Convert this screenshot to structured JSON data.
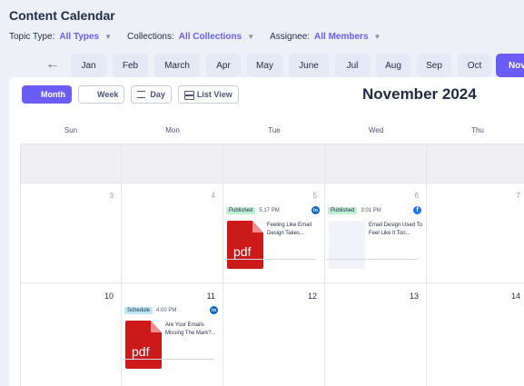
{
  "page_title": "Content Calendar",
  "filters": [
    {
      "label": "Topic Type:",
      "value": "All Types"
    },
    {
      "label": "Collections:",
      "value": "All Collections"
    },
    {
      "label": "Assignee:",
      "value": "All Members"
    }
  ],
  "months": [
    "Jan",
    "Feb",
    "March",
    "Apr",
    "May",
    "June",
    "Jul",
    "Aug",
    "Sep",
    "Oct",
    "Nov"
  ],
  "active_month": "Nov",
  "views": [
    "Month",
    "Week",
    "Day",
    "List View"
  ],
  "active_view": "Month",
  "period_title": "November 2024",
  "weekdays": [
    "Sun",
    "Mon",
    "Tue",
    "Wed",
    "Thu"
  ],
  "days": {
    "d3": "3",
    "d4": "4",
    "d5": "5",
    "d6": "6",
    "d7": "7",
    "d10": "10",
    "d11": "11",
    "d12": "12",
    "d13": "13",
    "d14": "14"
  },
  "posts": [
    {
      "status": "Published",
      "time": "5:17 PM",
      "network": "linkedin-icon",
      "title": "Feeling Like Email Design Takes...",
      "thumb_label": "pdf"
    },
    {
      "status": "Published",
      "time": "3:01 PM",
      "network": "facebook-icon",
      "title": "Email Design Used To Feel Like It Too...",
      "thumb_label": ""
    },
    {
      "status": "Schedule",
      "time": "4:00 PM",
      "network": "linkedin-icon",
      "title": "Are Your Emails Missing The Mark?...",
      "thumb_label": "pdf"
    }
  ],
  "colors": {
    "accent": "#6b5cf6",
    "published": "#bff0d4",
    "schedule": "#bde6f7",
    "pdf": "#cc1a1a",
    "linkedin": "#0a66c2",
    "facebook": "#1877f2"
  }
}
